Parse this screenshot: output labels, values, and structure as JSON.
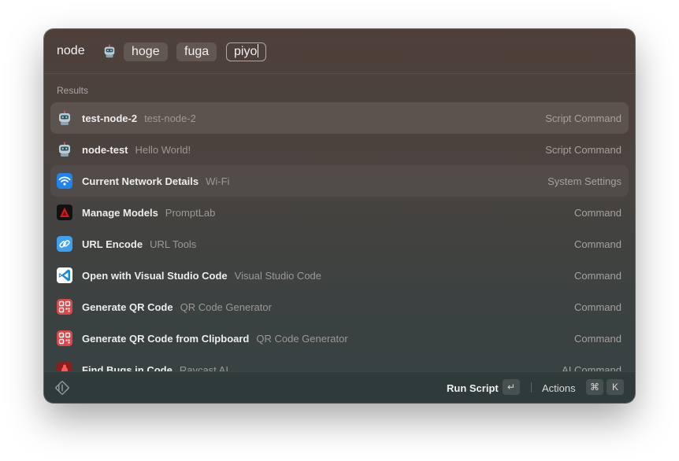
{
  "search": {
    "command_name": "node",
    "command_icon": "robot-icon",
    "arguments": [
      "hoge",
      "fuga",
      "piyo"
    ]
  },
  "results": {
    "section_title": "Results",
    "items": [
      {
        "icon": "robot-icon",
        "title": "test-node-2",
        "subtitle": "test-node-2",
        "accessory": "Script Command"
      },
      {
        "icon": "robot-icon",
        "title": "node-test",
        "subtitle": "Hello World!",
        "accessory": "Script Command"
      },
      {
        "icon": "wifi-icon",
        "title": "Current Network Details",
        "subtitle": "Wi-Fi",
        "accessory": "System Settings"
      },
      {
        "icon": "promptlab-icon",
        "title": "Manage Models",
        "subtitle": "PromptLab",
        "accessory": "Command"
      },
      {
        "icon": "link-icon",
        "title": "URL Encode",
        "subtitle": "URL Tools",
        "accessory": "Command"
      },
      {
        "icon": "vscode-icon",
        "title": "Open with Visual Studio Code",
        "subtitle": "Visual Studio Code",
        "accessory": "Command"
      },
      {
        "icon": "qr-code-icon",
        "title": "Generate QR Code",
        "subtitle": "QR Code Generator",
        "accessory": "Command"
      },
      {
        "icon": "qr-code-icon",
        "title": "Generate QR Code from Clipboard",
        "subtitle": "QR Code Generator",
        "accessory": "Command"
      },
      {
        "icon": "bug-icon",
        "title": "Find Bugs in Code",
        "subtitle": "Raycast AI",
        "accessory": "AI Command"
      }
    ]
  },
  "action_bar": {
    "logo": "raycast-logo-icon",
    "primary_action": "Run Script",
    "primary_shortcut": "↵",
    "actions_label": "Actions",
    "actions_shortcut_keys": [
      "⌘",
      "K"
    ]
  },
  "colors": {
    "wifi_blue": "#1f84f0",
    "promptlab_red": "#d11a1a",
    "link_blue": "#3ea0f0",
    "vscode_blue": "#1a8ad8",
    "qr_red": "#e0454a"
  }
}
